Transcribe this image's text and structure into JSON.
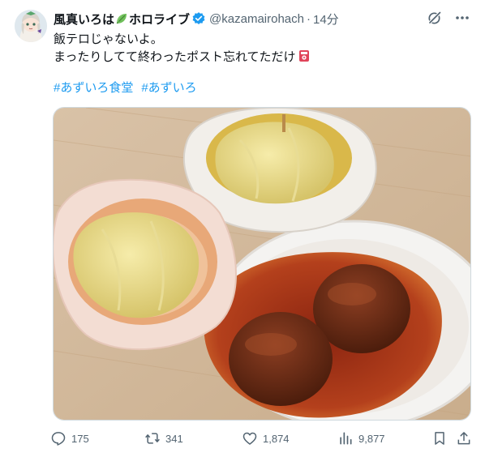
{
  "tweet": {
    "display_name": "風真いろは",
    "display_name_suffix": "ホロライブ",
    "handle": "@kazamairohach",
    "separator": "·",
    "time": "14分",
    "lines": [
      "飯テロじゃないよ。",
      "まったりしてて終わったポスト忘れてただけ"
    ],
    "hashtags": [
      "#あずいろ食堂",
      "#あずいろ"
    ]
  },
  "icons": {
    "avatar": "avatar-image",
    "name_emoji": "leaf-icon",
    "verified": "verified-badge-icon",
    "grok": "grok-icon",
    "more": "more-icon",
    "text_emoji": "postbox-icon"
  },
  "actions": {
    "reply_count": "175",
    "repost_count": "341",
    "like_count": "1,874",
    "view_count": "9,877"
  },
  "colors": {
    "link": "#1d9bf0",
    "verified": "#1d9bf0",
    "secondary_text": "#536471"
  }
}
